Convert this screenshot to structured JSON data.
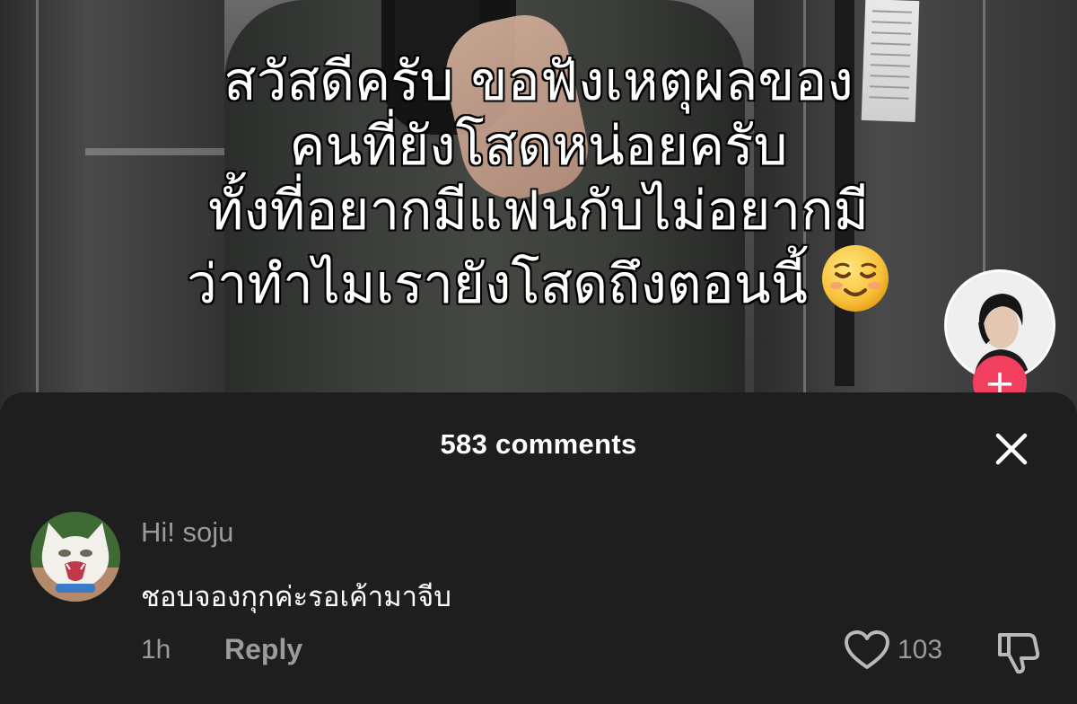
{
  "video": {
    "caption_lines": [
      "สวัสดีครับ ขอฟังเหตุผลของ",
      "คนที่ยังโสดหน่อยครับ",
      "ทั้งที่อยากมีแฟนกับไม่อยากมี",
      "ว่าทำไมเรายังโสดถึงตอนนี้"
    ],
    "caption_emoji": "smiling-face-emoji",
    "follow_label": "+"
  },
  "sheet": {
    "title": "583 comments",
    "close_icon": "close-icon"
  },
  "comment": {
    "username": "Hi! soju",
    "text": "ชอบจองกุกค่ะรอเค้ามาจีบ",
    "time": "1h",
    "reply_label": "Reply",
    "like_count": "103",
    "like_icon": "heart-outline-icon",
    "dislike_icon": "thumbs-down-icon"
  },
  "colors": {
    "sheet_bg": "#1e1e1e",
    "follow_accent": "#f23f5f",
    "muted_text": "#9b9b9b"
  }
}
